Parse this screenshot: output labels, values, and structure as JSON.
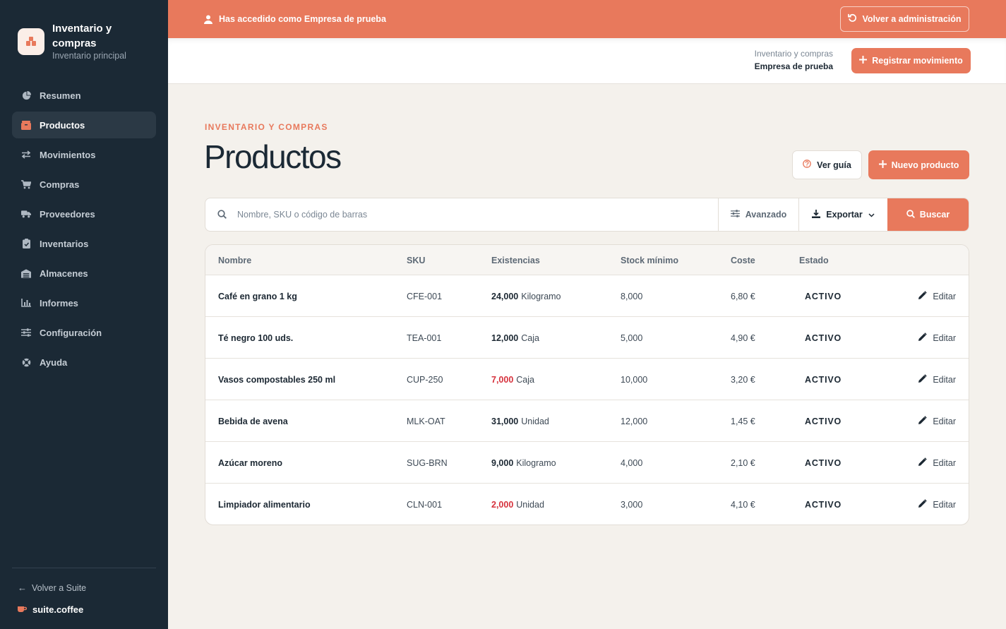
{
  "app": {
    "title": "Inventario y compras",
    "subtitle": "Inventario principal"
  },
  "nav": [
    {
      "label": "Resumen",
      "icon": "pie-chart-icon",
      "active": false
    },
    {
      "label": "Productos",
      "icon": "box-icon",
      "active": true
    },
    {
      "label": "Movimientos",
      "icon": "swap-arrows-icon",
      "active": false
    },
    {
      "label": "Compras",
      "icon": "cart-icon",
      "active": false
    },
    {
      "label": "Proveedores",
      "icon": "truck-icon",
      "active": false
    },
    {
      "label": "Inventarios",
      "icon": "clipboard-check-icon",
      "active": false
    },
    {
      "label": "Almacenes",
      "icon": "warehouse-icon",
      "active": false
    },
    {
      "label": "Informes",
      "icon": "bar-chart-icon",
      "active": false
    },
    {
      "label": "Configuración",
      "icon": "sliders-icon",
      "active": false
    },
    {
      "label": "Ayuda",
      "icon": "lifebuoy-icon",
      "active": false
    }
  ],
  "sidebar_footer": {
    "back_label": "Volver a Suite",
    "brand": "suite.coffee"
  },
  "banner": {
    "text": "Has accedido como Empresa de prueba",
    "button": "Volver a administración"
  },
  "header": {
    "context_top": "Inventario y compras",
    "context_bottom": "Empresa de prueba",
    "register_button": "Registrar movimiento"
  },
  "page": {
    "eyebrow": "INVENTARIO Y COMPRAS",
    "title": "Productos",
    "guide_button": "Ver guía",
    "new_button": "Nuevo producto"
  },
  "search": {
    "placeholder": "Nombre, SKU o código de barras",
    "advanced": "Avanzado",
    "export": "Exportar",
    "submit": "Buscar"
  },
  "table": {
    "headers": {
      "name": "Nombre",
      "sku": "SKU",
      "stock": "Existencias",
      "min": "Stock mínimo",
      "cost": "Coste",
      "status": "Estado"
    },
    "edit_label": "Editar",
    "rows": [
      {
        "name": "Café en grano 1 kg",
        "sku": "CFE-001",
        "qty": "24,000",
        "unit": "Kilogramo",
        "low": false,
        "min": "8,000",
        "cost": "6,80 €",
        "status": "ACTIVO"
      },
      {
        "name": "Té negro 100 uds.",
        "sku": "TEA-001",
        "qty": "12,000",
        "unit": "Caja",
        "low": false,
        "min": "5,000",
        "cost": "4,90 €",
        "status": "ACTIVO"
      },
      {
        "name": "Vasos compostables 250 ml",
        "sku": "CUP-250",
        "qty": "7,000",
        "unit": "Caja",
        "low": true,
        "min": "10,000",
        "cost": "3,20 €",
        "status": "ACTIVO"
      },
      {
        "name": "Bebida de avena",
        "sku": "MLK-OAT",
        "qty": "31,000",
        "unit": "Unidad",
        "low": false,
        "min": "12,000",
        "cost": "1,45 €",
        "status": "ACTIVO"
      },
      {
        "name": "Azúcar moreno",
        "sku": "SUG-BRN",
        "qty": "9,000",
        "unit": "Kilogramo",
        "low": false,
        "min": "4,000",
        "cost": "2,10 €",
        "status": "ACTIVO"
      },
      {
        "name": "Limpiador alimentario",
        "sku": "CLN-001",
        "qty": "2,000",
        "unit": "Unidad",
        "low": true,
        "min": "3,000",
        "cost": "4,10 €",
        "status": "ACTIVO"
      }
    ]
  },
  "colors": {
    "accent": "#e8795c",
    "sidebar": "#1b2935",
    "low_stock": "#d6323d",
    "background": "#f4f1ec"
  }
}
